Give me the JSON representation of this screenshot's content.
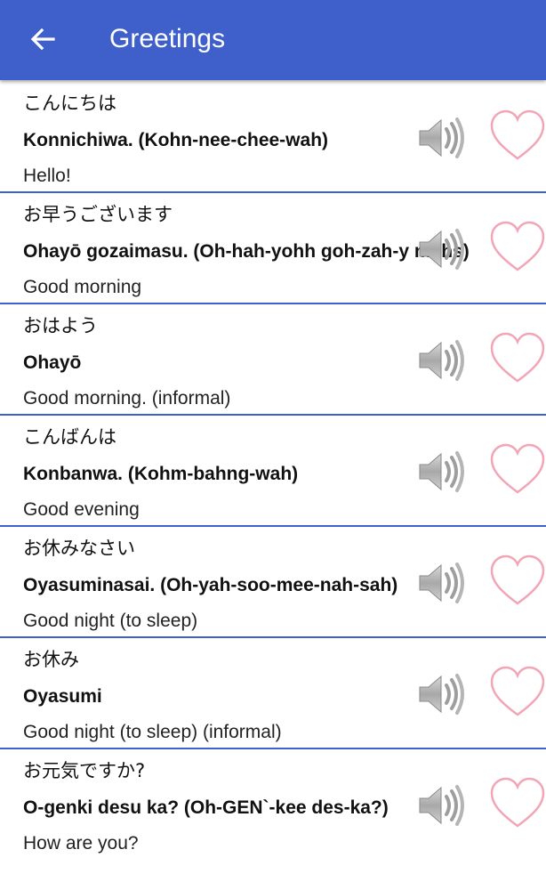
{
  "appbar": {
    "title": "Greetings",
    "back_icon": "arrow-left-icon",
    "background": "#3F5FCB"
  },
  "colors": {
    "divider": "#3F5FCB",
    "heart_outline": "#F2A5B5",
    "speaker": "#9E9E9E"
  },
  "phrases": [
    {
      "japanese": "こんにちは",
      "romaji": "Konnichiwa. (Kohn-nee-chee-wah)",
      "english": "Hello!"
    },
    {
      "japanese": "お早うございます",
      "romaji": "Ohayō gozaimasu. (Oh-hah-yohh goh-zah-y mahs)",
      "english": "Good morning"
    },
    {
      "japanese": "おはよう",
      "romaji": "Ohayō",
      "english": "Good morning. (informal)"
    },
    {
      "japanese": "こんばんは",
      "romaji": "Konbanwa. (Kohm-bahng-wah)",
      "english": "Good evening"
    },
    {
      "japanese": "お休みなさい",
      "romaji": "Oyasuminasai. (Oh-yah-soo-mee-nah-sah)",
      "english": "Good night (to sleep)"
    },
    {
      "japanese": "お休み",
      "romaji": "Oyasumi",
      "english": "Good night (to sleep) (informal)"
    },
    {
      "japanese": "お元気ですか?",
      "romaji": "O-genki desu ka? (Oh-GEN`-kee des-ka?)",
      "english": "How are you?"
    }
  ],
  "icons": {
    "speaker": "speaker-icon",
    "favorite": "heart-outline-icon"
  }
}
